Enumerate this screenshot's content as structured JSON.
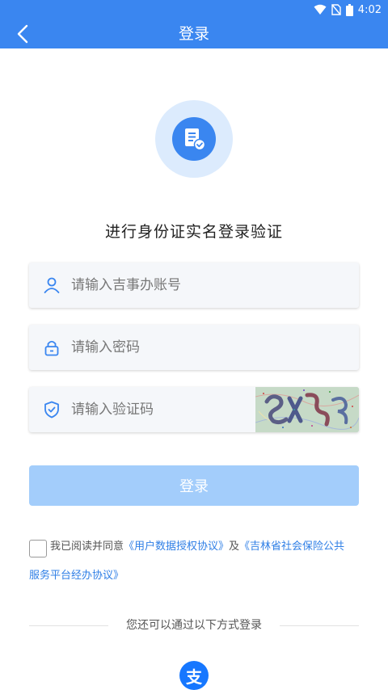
{
  "status_bar": {
    "time": "4:02"
  },
  "header": {
    "title": "登录",
    "back_icon": "back-arrow-icon"
  },
  "hero": {
    "icon": "document-verified-icon"
  },
  "heading": "进行身份证实名登录验证",
  "form": {
    "account": {
      "icon": "user-icon",
      "placeholder": "请输入吉事办账号",
      "value": ""
    },
    "password": {
      "icon": "lock-icon",
      "placeholder": "请输入密码",
      "value": ""
    },
    "captcha": {
      "icon": "shield-check-icon",
      "placeholder": "请输入验证码",
      "value": ""
    }
  },
  "login_button": "登录",
  "agreement": {
    "prefix": "我已阅读并同意",
    "link1": "《用户数据授权协议》",
    "connector": "及",
    "link2_part1": "《吉林省社会保险公共",
    "link2_part2": "服务平台经办协议》",
    "checked": false
  },
  "alt_login": {
    "label": "您还可以通过以下方式登录",
    "option_icon": "alipay-icon",
    "option_glyph": "支"
  },
  "colors": {
    "primary": "#3a86f0",
    "button_disabled": "#a3cdfb",
    "link": "#2f7fe6"
  }
}
